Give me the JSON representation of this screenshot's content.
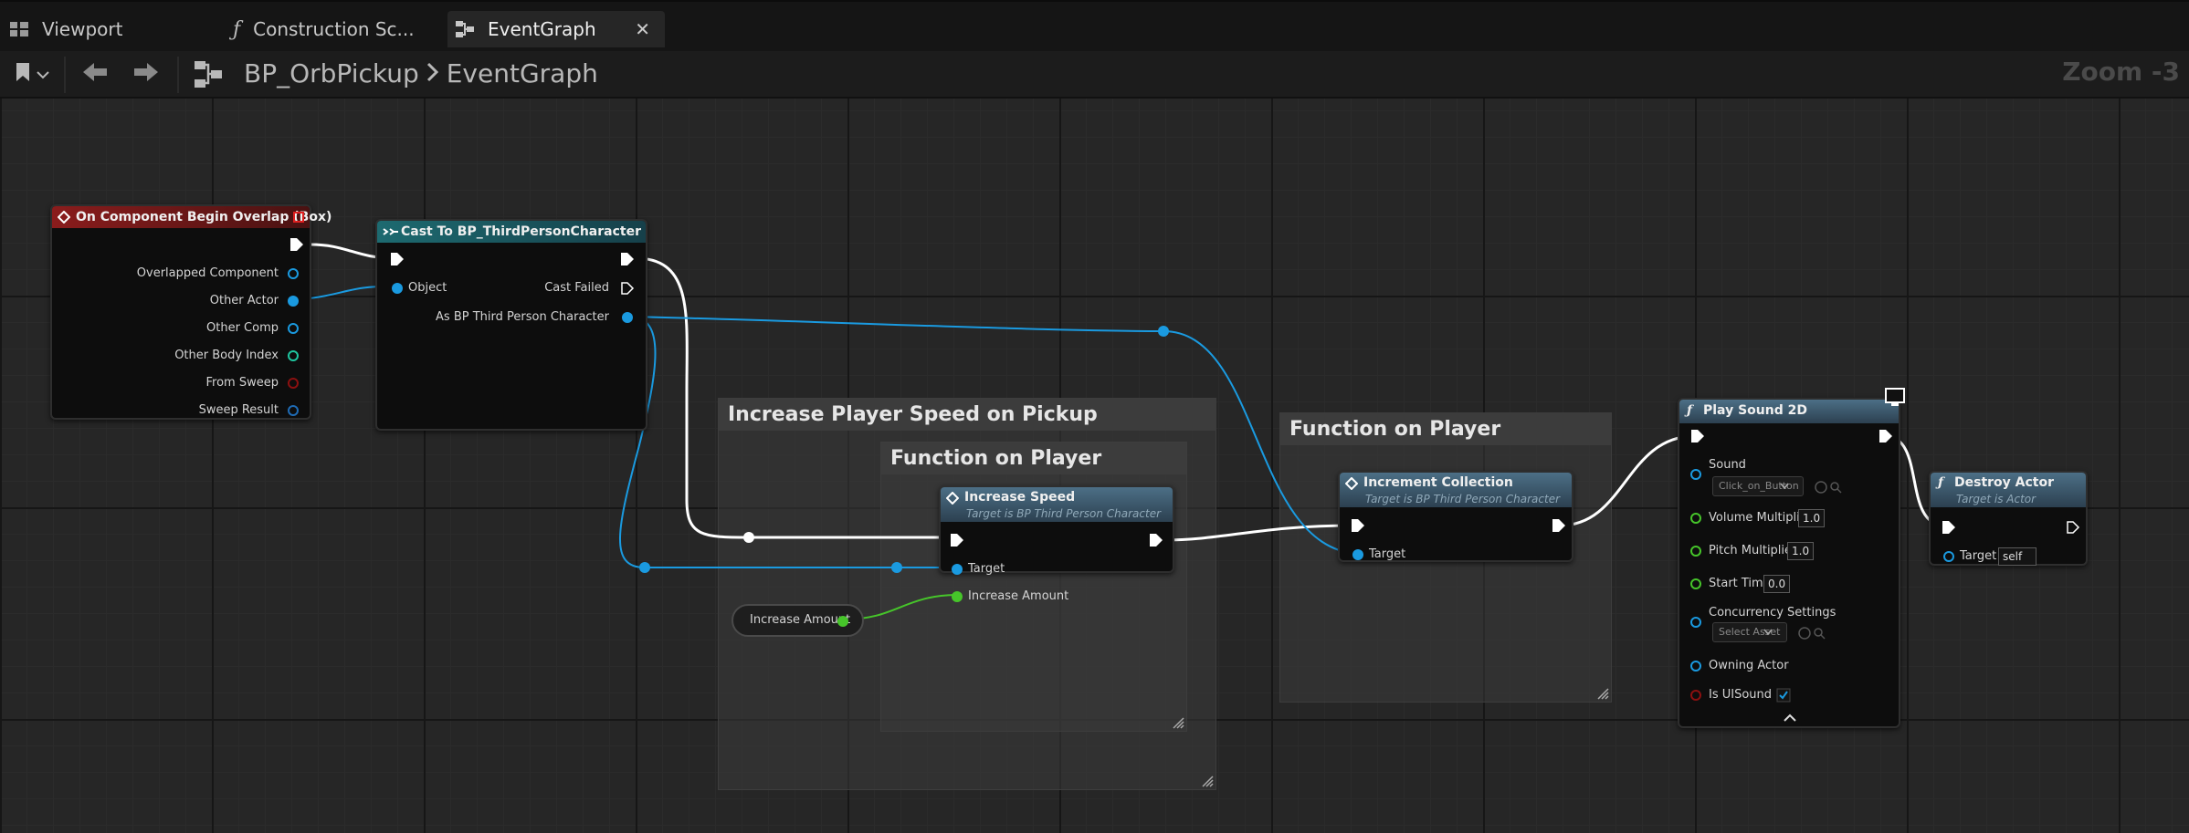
{
  "tabs": [
    {
      "label": "Viewport",
      "icon": "viewport-grid-icon"
    },
    {
      "label": "Construction Sc...",
      "icon": "function-icon"
    },
    {
      "label": "EventGraph",
      "icon": "event-graph-icon"
    }
  ],
  "toolbar": {
    "breadcrumb_root": "BP_OrbPickup",
    "breadcrumb_current": "EventGraph",
    "zoom_label": "Zoom -3"
  },
  "comments": {
    "speed": "Increase Player Speed on Pickup",
    "function_on_player_1": "Function on Player",
    "function_on_player_2": "Function on Player"
  },
  "nodes": {
    "overlap": {
      "title": "On Component Begin Overlap (Box)",
      "pins": [
        "Overlapped Component",
        "Other Actor",
        "Other Comp",
        "Other Body Index",
        "From Sweep",
        "Sweep Result"
      ]
    },
    "cast": {
      "title": "Cast To BP_ThirdPersonCharacter",
      "object": "Object",
      "cast_failed": "Cast Failed",
      "as_character": "As BP Third Person Character"
    },
    "increase_speed": {
      "title": "Increase Speed",
      "subtitle": "Target is BP Third Person Character",
      "target": "Target",
      "increase_amount": "Increase Amount"
    },
    "increase_amount_var": {
      "label": "Increase Amount"
    },
    "increment": {
      "title": "Increment Collection",
      "subtitle": "Target is BP Third Person Character",
      "target": "Target"
    },
    "play_sound": {
      "title": "Play Sound 2D",
      "sound": "Sound",
      "sound_value": "Click_on_Button",
      "volume": "Volume Multiplier",
      "volume_value": "1.0",
      "pitch": "Pitch Multiplier",
      "pitch_value": "1.0",
      "start_time": "Start Time",
      "start_time_value": "0.0",
      "concurrency": "Concurrency Settings",
      "concurrency_value": "Select Asset",
      "owning_actor": "Owning Actor",
      "is_ui_sound": "Is UISound"
    },
    "destroy": {
      "title": "Destroy Actor",
      "subtitle": "Target is Actor",
      "target": "Target",
      "target_value": "self"
    }
  },
  "colors": {
    "event_header": "#8a1c1c",
    "cast_header": "#1d6a70",
    "function_header": "#3f6077",
    "exec_wire": "#ffffff",
    "object_pin": "#1a9ae0",
    "float_pin": "#46c52a",
    "bool_pin": "#8c1010",
    "struct_pin": "#1f6bb5",
    "int_pin": "#1fc6a0"
  }
}
